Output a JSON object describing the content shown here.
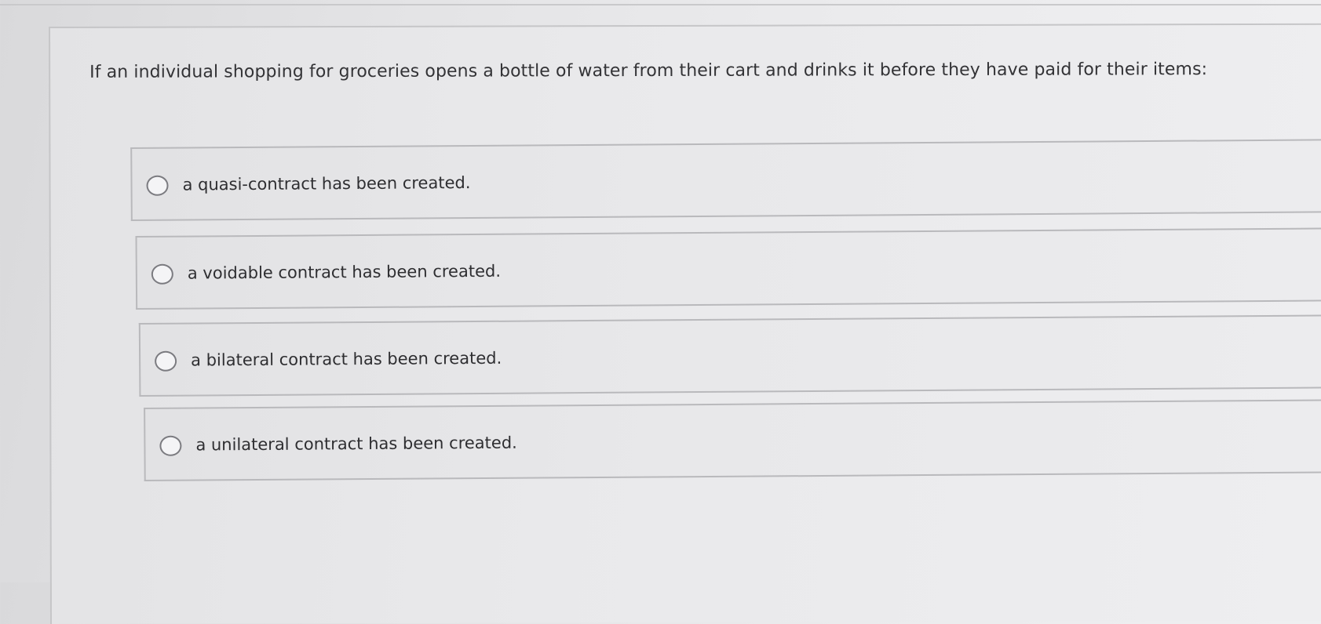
{
  "question": {
    "text": "If an individual shopping for groceries opens a bottle of water from their cart and drinks it before they have paid for their items:"
  },
  "options": [
    {
      "label": "a quasi-contract has been created."
    },
    {
      "label": "a voidable contract has been created."
    },
    {
      "label": "a bilateral contract has been created."
    },
    {
      "label": "a unilateral contract has been created."
    }
  ],
  "colors": {
    "text": "#333336",
    "border": "#b9b9bc",
    "radio_border": "#7b7b80"
  }
}
